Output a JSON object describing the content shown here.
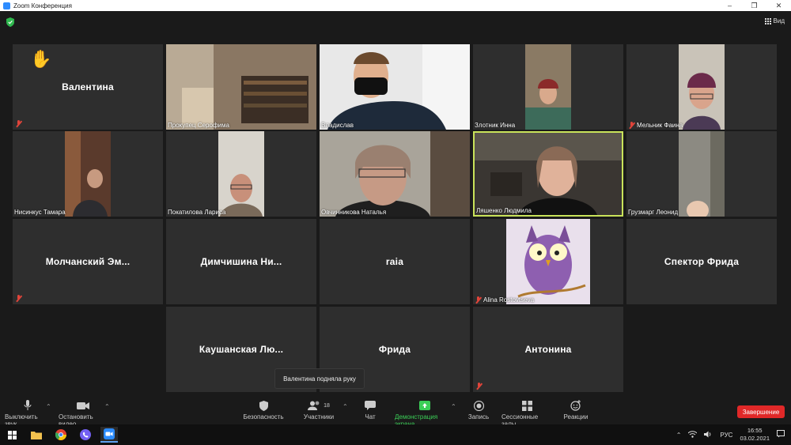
{
  "window": {
    "title": "Zoom Конференция",
    "minimize": "–",
    "maximize": "❐",
    "close": "✕"
  },
  "meeting": {
    "view_label": "Вид",
    "shield_icon": "green-shield-icon"
  },
  "tiles": [
    {
      "name": "Валентина",
      "type": "avatar",
      "muted": true,
      "hand_raised": true
    },
    {
      "name": "Прокупец Серофима",
      "type": "video",
      "muted": false
    },
    {
      "name": "Владислав",
      "type": "video",
      "muted": false
    },
    {
      "name": "Злотник Инна",
      "type": "video",
      "muted": false
    },
    {
      "name": "Мельник Фаина",
      "type": "video",
      "muted": true
    },
    {
      "name": "Нисинкус Тамара",
      "type": "video",
      "muted": false
    },
    {
      "name": "Покатилова Лариса",
      "type": "video",
      "muted": false
    },
    {
      "name": "Овчинникова Наталья",
      "type": "video",
      "muted": false
    },
    {
      "name": "Ляшенко Людмила",
      "type": "video",
      "muted": false,
      "active_speaker": true
    },
    {
      "name": "Грузмарг Леонид",
      "type": "video",
      "muted": false
    },
    {
      "name": "Молчанский Эм...",
      "type": "avatar",
      "muted": true
    },
    {
      "name": "Димчишина Ни...",
      "type": "avatar",
      "muted": false
    },
    {
      "name": "raia",
      "type": "avatar",
      "muted": false
    },
    {
      "name": "Alina Rostovtseva",
      "type": "image",
      "muted": true
    },
    {
      "name": "Спектор Фрида",
      "type": "avatar",
      "muted": false
    },
    {
      "name": "Каушанская Лю...",
      "type": "avatar",
      "muted": false
    },
    {
      "name": "Фрида",
      "type": "avatar",
      "muted": false
    },
    {
      "name": "Антонина",
      "type": "avatar",
      "muted": true
    }
  ],
  "tooltip": "Валентина подняла руку",
  "toolbar": {
    "mute": "Выключить звук",
    "video": "Остановить видео",
    "security": "Безопасность",
    "participants": "Участники",
    "participants_count": "18",
    "chat": "Чат",
    "share": "Демонстрация экрана",
    "record": "Запись",
    "breakout": "Сессионные залы",
    "reactions": "Реакции",
    "end": "Завершение"
  },
  "taskbar": {
    "start_icon": "windows-start-icon",
    "apps": [
      "file-explorer-icon",
      "chrome-icon",
      "viber-icon",
      "zoom-icon"
    ],
    "lang": "РУС",
    "time": "16:55",
    "date": "03.02.2021"
  },
  "colors": {
    "active_speaker_border": "#c9e35a",
    "share_green": "#3bcf57",
    "end_red": "#e02828",
    "zoom_blue": "#2d8cff"
  }
}
